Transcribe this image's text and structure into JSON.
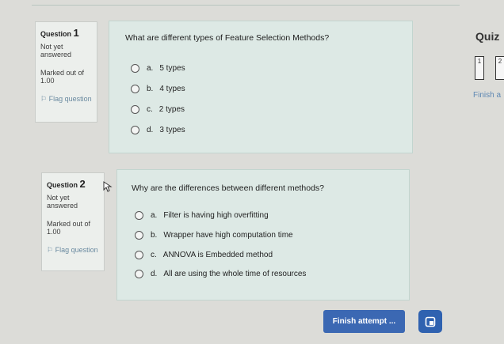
{
  "questions": [
    {
      "label": "Question",
      "number": "1",
      "state": "Not yet answered",
      "marked": "Marked out of 1.00",
      "flag": "Flag question",
      "text": "What are different types of Feature Selection Methods?",
      "options": [
        {
          "letter": "a.",
          "text": "5 types"
        },
        {
          "letter": "b.",
          "text": "4 types"
        },
        {
          "letter": "c.",
          "text": "2 types"
        },
        {
          "letter": "d.",
          "text": "3 types"
        }
      ]
    },
    {
      "label": "Question",
      "number": "2",
      "state": "Not yet answered",
      "marked": "Marked out of 1.00",
      "flag": "Flag question",
      "text": "Why are the differences between different methods?",
      "options": [
        {
          "letter": "a.",
          "text": "Filter is having high overfitting"
        },
        {
          "letter": "b.",
          "text": "Wrapper have high computation time"
        },
        {
          "letter": "c.",
          "text": "ANNOVA is Embedded method"
        },
        {
          "letter": "d.",
          "text": "All are  using the whole time of resources"
        }
      ]
    }
  ],
  "sidebar": {
    "title": "Quiz",
    "nav": [
      "1",
      "2"
    ],
    "finish_link": "Finish a"
  },
  "footer": {
    "finish_button": "Finish attempt ..."
  },
  "colors": {
    "accent": "#3b68b3",
    "content_bg": "#dde9e5",
    "info_bg": "#ecefec"
  }
}
